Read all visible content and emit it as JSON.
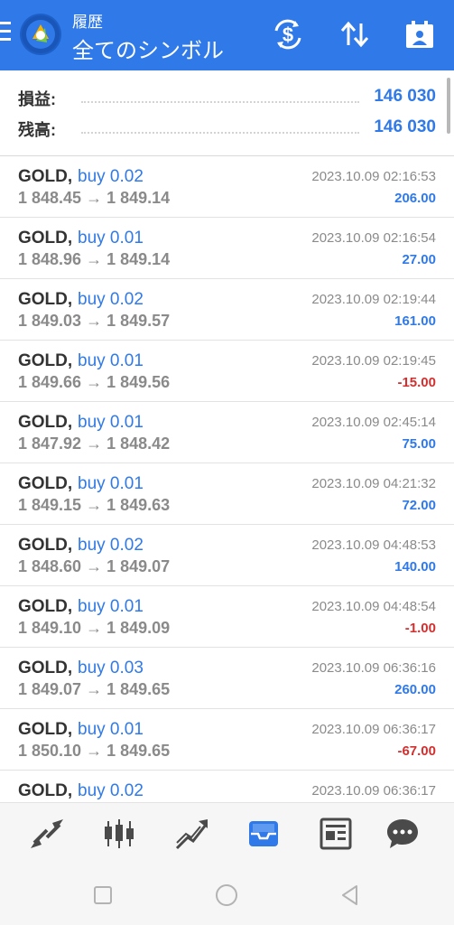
{
  "header": {
    "subtitle": "履歴",
    "title": "全てのシンボル",
    "icons": [
      "menu-icon",
      "app-logo",
      "currency-exchange-icon",
      "sort-icon",
      "calendar-person-icon"
    ]
  },
  "summary": {
    "profit_label": "損益:",
    "profit_value": "146 030",
    "balance_label": "残高:",
    "balance_value": "146 030"
  },
  "colors": {
    "accent": "#2f79e8",
    "positive": "#2f79e8",
    "negative": "#d32f2f",
    "muted": "#8a8a8a"
  },
  "deals": [
    {
      "symbol": "GOLD,",
      "side": "buy 0.02",
      "prices": "1 848.45 → 1 849.14",
      "time": "2023.10.09 02:16:53",
      "profit": "206.00",
      "negative": false
    },
    {
      "symbol": "GOLD,",
      "side": "buy 0.01",
      "prices": "1 848.96 → 1 849.14",
      "time": "2023.10.09 02:16:54",
      "profit": "27.00",
      "negative": false
    },
    {
      "symbol": "GOLD,",
      "side": "buy 0.02",
      "prices": "1 849.03 → 1 849.57",
      "time": "2023.10.09 02:19:44",
      "profit": "161.00",
      "negative": false
    },
    {
      "symbol": "GOLD,",
      "side": "buy 0.01",
      "prices": "1 849.66 → 1 849.56",
      "time": "2023.10.09 02:19:45",
      "profit": "-15.00",
      "negative": true
    },
    {
      "symbol": "GOLD,",
      "side": "buy 0.01",
      "prices": "1 847.92 → 1 848.42",
      "time": "2023.10.09 02:45:14",
      "profit": "75.00",
      "negative": false
    },
    {
      "symbol": "GOLD,",
      "side": "buy 0.01",
      "prices": "1 849.15 → 1 849.63",
      "time": "2023.10.09 04:21:32",
      "profit": "72.00",
      "negative": false
    },
    {
      "symbol": "GOLD,",
      "side": "buy 0.02",
      "prices": "1 848.60 → 1 849.07",
      "time": "2023.10.09 04:48:53",
      "profit": "140.00",
      "negative": false
    },
    {
      "symbol": "GOLD,",
      "side": "buy 0.01",
      "prices": "1 849.10 → 1 849.09",
      "time": "2023.10.09 04:48:54",
      "profit": "-1.00",
      "negative": true
    },
    {
      "symbol": "GOLD,",
      "side": "buy 0.03",
      "prices": "1 849.07 → 1 849.65",
      "time": "2023.10.09 06:36:16",
      "profit": "260.00",
      "negative": false
    },
    {
      "symbol": "GOLD,",
      "side": "buy 0.01",
      "prices": "1 850.10 → 1 849.65",
      "time": "2023.10.09 06:36:17",
      "profit": "-67.00",
      "negative": true
    },
    {
      "symbol": "GOLD,",
      "side": "buy 0.02",
      "prices": "",
      "time": "2023.10.09 06:36:17",
      "profit": "",
      "negative": false
    }
  ],
  "bottom_nav": {
    "items": [
      "quotes-icon",
      "chart-candles-icon",
      "trade-icon",
      "history-icon",
      "news-icon",
      "messages-icon"
    ],
    "active": "history-icon"
  },
  "system_nav": {
    "items": [
      "recent-apps-icon",
      "home-icon",
      "back-icon"
    ]
  }
}
